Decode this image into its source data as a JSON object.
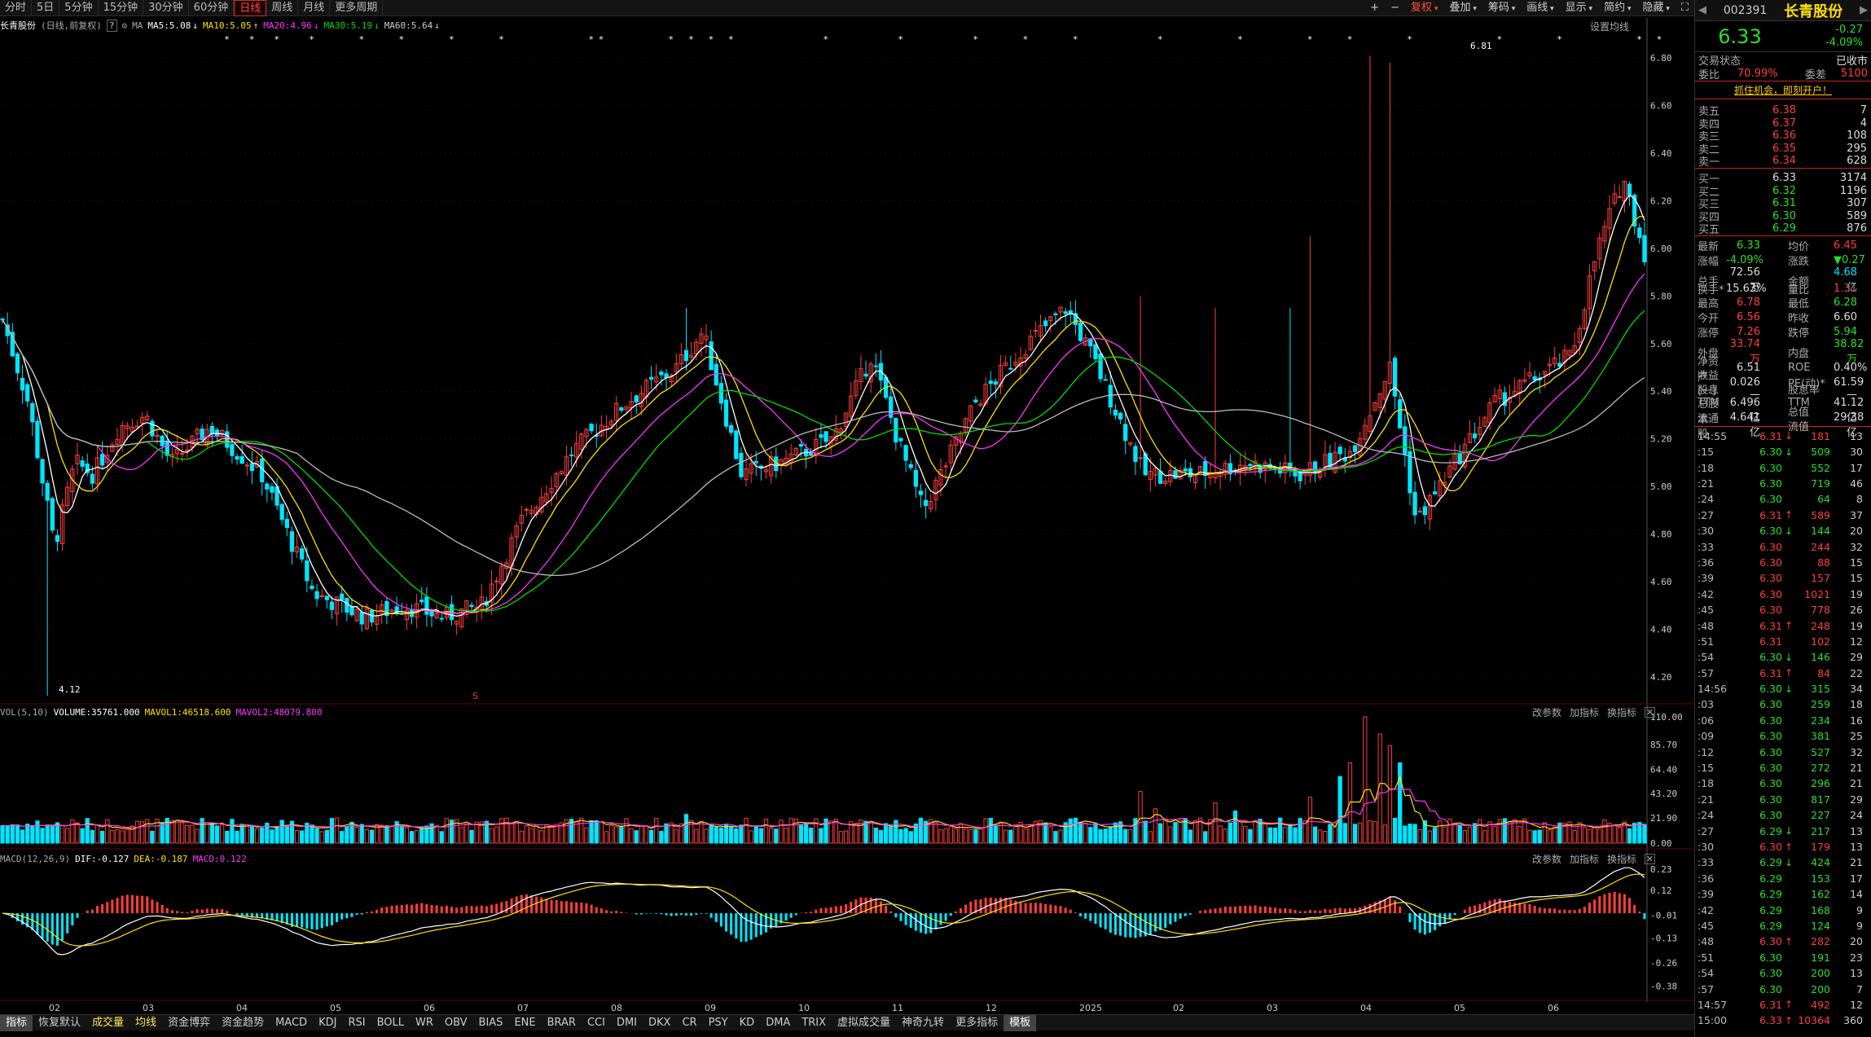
{
  "periods": [
    "分时",
    "5日",
    "5分钟",
    "15分钟",
    "30分钟",
    "60分钟",
    "日线",
    "周线",
    "月线",
    "更多周期"
  ],
  "active_period": "日线",
  "right_tools": [
    "复权",
    "叠加",
    "筹码",
    "画线",
    "显示",
    "简约",
    "隐藏"
  ],
  "active_tool": "复权",
  "stock": {
    "name": "长青股份",
    "code": "002391",
    "mode": "(日线,前复权)",
    "price": "6.33",
    "change": "-0.27",
    "pct": "-4.09%"
  },
  "ma": {
    "label": "MA",
    "ma5": "MA5:5.08",
    "ma10": "MA10:5.05",
    "ma20": "MA20:4.96",
    "ma30": "MA30:5.19",
    "ma60": "MA60:5.64",
    "settings": "设置均线"
  },
  "price_axis": [
    "6.80",
    "6.60",
    "6.40",
    "6.20",
    "6.00",
    "5.80",
    "5.60",
    "5.40",
    "5.20",
    "5.00",
    "4.80",
    "4.60",
    "4.40",
    "4.20"
  ],
  "high_label": "6.81",
  "low_label": "4.12",
  "marker_s": "S",
  "vol": {
    "label": "VOL(5,10)",
    "volume": "VOLUME:35761.000",
    "mavol1": "MAVOL1:46518.600",
    "mavol2": "MAVOL2:48079.800",
    "axis": [
      "110.00",
      "85.70",
      "64.40",
      "43.20",
      "21.90",
      "0.00"
    ]
  },
  "macd": {
    "label": "MACD(12,26,9)",
    "dif": "DIF:-0.127",
    "dea": "DEA:-0.187",
    "macd": "MACD:0.122",
    "axis": [
      "0.23",
      "0.12",
      "-0.01",
      "-0.13",
      "-0.26",
      "-0.38"
    ]
  },
  "ind_actions": [
    "改参数",
    "加指标",
    "换指标"
  ],
  "x_axis": [
    "02",
    "03",
    "04",
    "05",
    "06",
    "07",
    "08",
    "09",
    "10",
    "11",
    "12",
    "2025",
    "02",
    "03",
    "04",
    "05",
    "06"
  ],
  "bottom_tabs": [
    "指标",
    "恢复默认",
    "成交量",
    "均线",
    "资金博弈",
    "资金趋势",
    "MACD",
    "KDJ",
    "RSI",
    "BOLL",
    "WR",
    "OBV",
    "BIAS",
    "ENE",
    "BRAR",
    "CCI",
    "DMI",
    "DKX",
    "CR",
    "PSY",
    "KD",
    "DMA",
    "TRIX",
    "虚拟成交量",
    "神奇九转",
    "更多指标",
    "模板"
  ],
  "panel": {
    "status": [
      [
        "交易状态",
        ""
      ],
      [
        "已收市",
        ""
      ]
    ],
    "weibi": {
      "label": "委比",
      "value": "70.99%",
      "label2": "委差",
      "value2": "5100"
    },
    "ad": "抓住机会，即刻开户！",
    "asks": [
      [
        "卖五",
        "6.38",
        "7"
      ],
      [
        "卖四",
        "6.37",
        "4"
      ],
      [
        "卖三",
        "6.36",
        "108"
      ],
      [
        "卖二",
        "6.35",
        "295"
      ],
      [
        "卖一",
        "6.34",
        "628"
      ]
    ],
    "bids": [
      [
        "买一",
        "6.33",
        "3174"
      ],
      [
        "买二",
        "6.32",
        "1196"
      ],
      [
        "买三",
        "6.31",
        "307"
      ],
      [
        "买四",
        "6.30",
        "589"
      ],
      [
        "买五",
        "6.29",
        "876"
      ]
    ],
    "quote": [
      [
        "最新",
        "6.33",
        "g",
        "均价",
        "6.45",
        "r"
      ],
      [
        "涨幅",
        "-4.09%",
        "g",
        "涨跌",
        "▼0.27",
        "g"
      ],
      [
        "总手",
        "72.56万",
        "w",
        "金额",
        "4.68亿",
        "c"
      ],
      [
        "换手*",
        "15.63%",
        "w",
        "量比",
        "1.31",
        "r"
      ],
      [
        "最高",
        "6.78",
        "r",
        "最低",
        "6.28",
        "g"
      ],
      [
        "今开",
        "6.56",
        "r",
        "昨收",
        "6.60",
        "w"
      ],
      [
        "涨停",
        "7.26",
        "r",
        "跌停",
        "5.94",
        "g"
      ],
      [
        "外盘",
        "33.74万",
        "r",
        "内盘",
        "38.82万",
        "g"
      ],
      [
        "净资产",
        "6.51",
        "w",
        "ROE",
        "0.40%",
        "w"
      ],
      [
        "收益(一)",
        "0.026",
        "w",
        "PE(动)*",
        "61.59",
        "w"
      ],
      [
        "股息TTM",
        "—",
        "w",
        "股息率TTM",
        "—",
        "w"
      ],
      [
        "总股本",
        "6.496亿",
        "w",
        "总值",
        "41.12亿",
        "w"
      ],
      [
        "流通股",
        "4.641亿",
        "w",
        "流值",
        "29.38亿",
        "w"
      ]
    ],
    "ticks": [
      [
        "14:55",
        "6.31",
        "↓",
        "181",
        "13",
        "r"
      ],
      [
        ":15",
        "6.30",
        "↓",
        "509",
        "30",
        "g"
      ],
      [
        ":18",
        "6.30",
        "",
        "552",
        "17",
        "g"
      ],
      [
        ":21",
        "6.30",
        "",
        "719",
        "46",
        "g"
      ],
      [
        ":24",
        "6.30",
        "",
        "64",
        "8",
        "g"
      ],
      [
        ":27",
        "6.31",
        "↑",
        "589",
        "37",
        "r"
      ],
      [
        ":30",
        "6.30",
        "↓",
        "144",
        "20",
        "g"
      ],
      [
        ":33",
        "6.30",
        "",
        "244",
        "32",
        "r"
      ],
      [
        ":36",
        "6.30",
        "",
        "88",
        "15",
        "r"
      ],
      [
        ":39",
        "6.30",
        "",
        "157",
        "15",
        "r"
      ],
      [
        ":42",
        "6.30",
        "",
        "1021",
        "19",
        "r"
      ],
      [
        ":45",
        "6.30",
        "",
        "778",
        "26",
        "r"
      ],
      [
        ":48",
        "6.31",
        "↑",
        "248",
        "19",
        "r"
      ],
      [
        ":51",
        "6.31",
        "",
        "102",
        "12",
        "r"
      ],
      [
        ":54",
        "6.30",
        "↓",
        "146",
        "29",
        "g"
      ],
      [
        ":57",
        "6.31",
        "↑",
        "84",
        "22",
        "r"
      ],
      [
        "14:56",
        "6.30",
        "↓",
        "315",
        "34",
        "g"
      ],
      [
        ":03",
        "6.30",
        "",
        "259",
        "18",
        "g"
      ],
      [
        ":06",
        "6.30",
        "",
        "234",
        "16",
        "g"
      ],
      [
        ":09",
        "6.30",
        "",
        "381",
        "25",
        "g"
      ],
      [
        ":12",
        "6.30",
        "",
        "527",
        "32",
        "g"
      ],
      [
        ":15",
        "6.30",
        "",
        "272",
        "21",
        "g"
      ],
      [
        ":18",
        "6.30",
        "",
        "296",
        "21",
        "g"
      ],
      [
        ":21",
        "6.30",
        "",
        "817",
        "29",
        "g"
      ],
      [
        ":24",
        "6.30",
        "",
        "227",
        "24",
        "g"
      ],
      [
        ":27",
        "6.29",
        "↓",
        "217",
        "13",
        "g"
      ],
      [
        ":30",
        "6.30",
        "↑",
        "179",
        "13",
        "r"
      ],
      [
        ":33",
        "6.29",
        "↓",
        "424",
        "21",
        "g"
      ],
      [
        ":36",
        "6.29",
        "",
        "153",
        "17",
        "g"
      ],
      [
        ":39",
        "6.29",
        "",
        "162",
        "14",
        "g"
      ],
      [
        ":42",
        "6.29",
        "",
        "168",
        "9",
        "g"
      ],
      [
        ":45",
        "6.29",
        "",
        "124",
        "9",
        "g"
      ],
      [
        ":48",
        "6.30",
        "↑",
        "282",
        "20",
        "r"
      ],
      [
        ":51",
        "6.30",
        "",
        "191",
        "23",
        "g"
      ],
      [
        ":54",
        "6.30",
        "",
        "200",
        "13",
        "g"
      ],
      [
        ":57",
        "6.30",
        "",
        "200",
        "7",
        "g"
      ],
      [
        "14:57",
        "6.31",
        "↑",
        "492",
        "12",
        "r"
      ],
      [
        "15:00",
        "6.33",
        "↑",
        "10364",
        "360",
        "r"
      ]
    ]
  },
  "colors": {
    "up": "#ff3d3d",
    "down": "#00e5ff",
    "ma5": "#ffffff",
    "ma10": "#ffe000",
    "ma20": "#ff33ff",
    "ma30": "#00dd00",
    "ma60": "#bbbbbb"
  }
}
